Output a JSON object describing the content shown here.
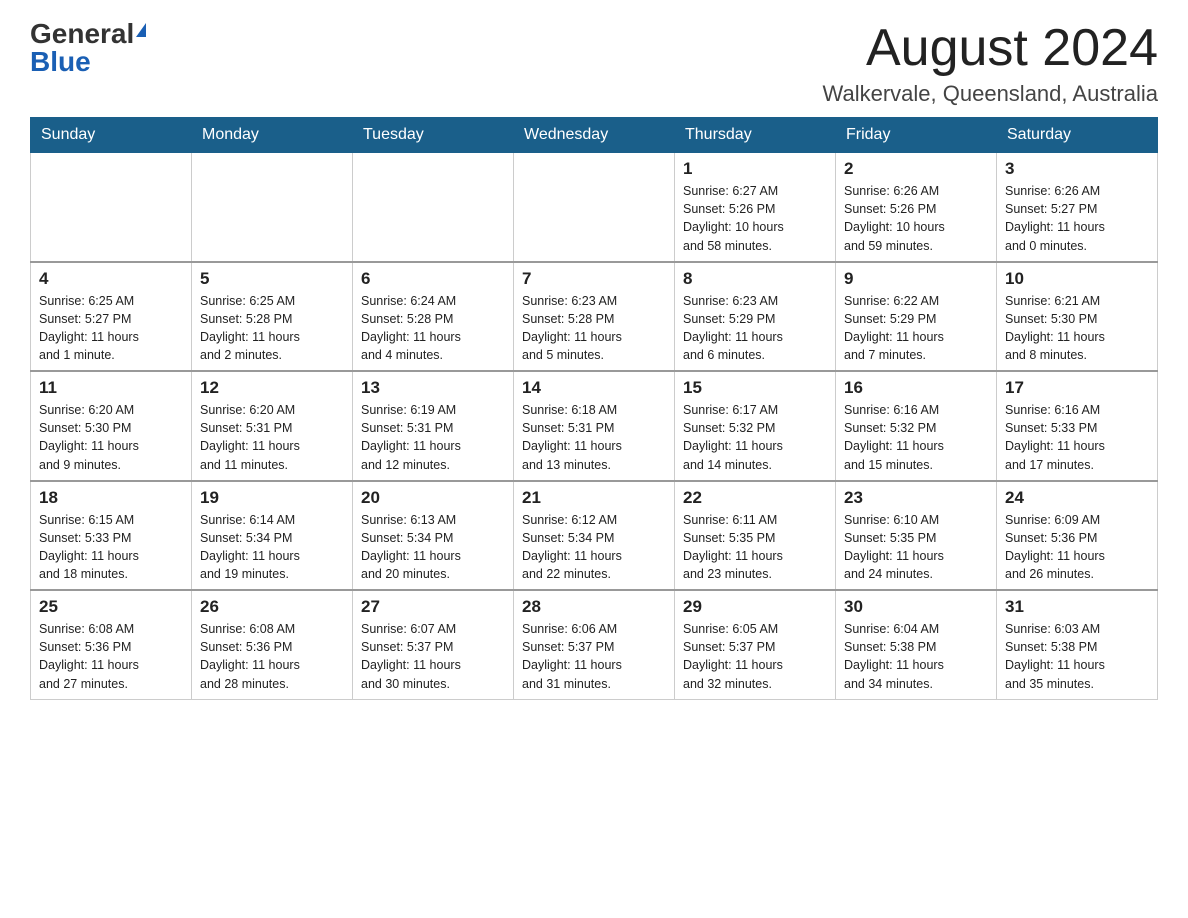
{
  "header": {
    "logo_general": "General",
    "logo_blue": "Blue",
    "month_title": "August 2024",
    "location": "Walkervale, Queensland, Australia"
  },
  "days_of_week": [
    "Sunday",
    "Monday",
    "Tuesday",
    "Wednesday",
    "Thursday",
    "Friday",
    "Saturday"
  ],
  "weeks": [
    [
      {
        "day": "",
        "info": ""
      },
      {
        "day": "",
        "info": ""
      },
      {
        "day": "",
        "info": ""
      },
      {
        "day": "",
        "info": ""
      },
      {
        "day": "1",
        "info": "Sunrise: 6:27 AM\nSunset: 5:26 PM\nDaylight: 10 hours\nand 58 minutes."
      },
      {
        "day": "2",
        "info": "Sunrise: 6:26 AM\nSunset: 5:26 PM\nDaylight: 10 hours\nand 59 minutes."
      },
      {
        "day": "3",
        "info": "Sunrise: 6:26 AM\nSunset: 5:27 PM\nDaylight: 11 hours\nand 0 minutes."
      }
    ],
    [
      {
        "day": "4",
        "info": "Sunrise: 6:25 AM\nSunset: 5:27 PM\nDaylight: 11 hours\nand 1 minute."
      },
      {
        "day": "5",
        "info": "Sunrise: 6:25 AM\nSunset: 5:28 PM\nDaylight: 11 hours\nand 2 minutes."
      },
      {
        "day": "6",
        "info": "Sunrise: 6:24 AM\nSunset: 5:28 PM\nDaylight: 11 hours\nand 4 minutes."
      },
      {
        "day": "7",
        "info": "Sunrise: 6:23 AM\nSunset: 5:28 PM\nDaylight: 11 hours\nand 5 minutes."
      },
      {
        "day": "8",
        "info": "Sunrise: 6:23 AM\nSunset: 5:29 PM\nDaylight: 11 hours\nand 6 minutes."
      },
      {
        "day": "9",
        "info": "Sunrise: 6:22 AM\nSunset: 5:29 PM\nDaylight: 11 hours\nand 7 minutes."
      },
      {
        "day": "10",
        "info": "Sunrise: 6:21 AM\nSunset: 5:30 PM\nDaylight: 11 hours\nand 8 minutes."
      }
    ],
    [
      {
        "day": "11",
        "info": "Sunrise: 6:20 AM\nSunset: 5:30 PM\nDaylight: 11 hours\nand 9 minutes."
      },
      {
        "day": "12",
        "info": "Sunrise: 6:20 AM\nSunset: 5:31 PM\nDaylight: 11 hours\nand 11 minutes."
      },
      {
        "day": "13",
        "info": "Sunrise: 6:19 AM\nSunset: 5:31 PM\nDaylight: 11 hours\nand 12 minutes."
      },
      {
        "day": "14",
        "info": "Sunrise: 6:18 AM\nSunset: 5:31 PM\nDaylight: 11 hours\nand 13 minutes."
      },
      {
        "day": "15",
        "info": "Sunrise: 6:17 AM\nSunset: 5:32 PM\nDaylight: 11 hours\nand 14 minutes."
      },
      {
        "day": "16",
        "info": "Sunrise: 6:16 AM\nSunset: 5:32 PM\nDaylight: 11 hours\nand 15 minutes."
      },
      {
        "day": "17",
        "info": "Sunrise: 6:16 AM\nSunset: 5:33 PM\nDaylight: 11 hours\nand 17 minutes."
      }
    ],
    [
      {
        "day": "18",
        "info": "Sunrise: 6:15 AM\nSunset: 5:33 PM\nDaylight: 11 hours\nand 18 minutes."
      },
      {
        "day": "19",
        "info": "Sunrise: 6:14 AM\nSunset: 5:34 PM\nDaylight: 11 hours\nand 19 minutes."
      },
      {
        "day": "20",
        "info": "Sunrise: 6:13 AM\nSunset: 5:34 PM\nDaylight: 11 hours\nand 20 minutes."
      },
      {
        "day": "21",
        "info": "Sunrise: 6:12 AM\nSunset: 5:34 PM\nDaylight: 11 hours\nand 22 minutes."
      },
      {
        "day": "22",
        "info": "Sunrise: 6:11 AM\nSunset: 5:35 PM\nDaylight: 11 hours\nand 23 minutes."
      },
      {
        "day": "23",
        "info": "Sunrise: 6:10 AM\nSunset: 5:35 PM\nDaylight: 11 hours\nand 24 minutes."
      },
      {
        "day": "24",
        "info": "Sunrise: 6:09 AM\nSunset: 5:36 PM\nDaylight: 11 hours\nand 26 minutes."
      }
    ],
    [
      {
        "day": "25",
        "info": "Sunrise: 6:08 AM\nSunset: 5:36 PM\nDaylight: 11 hours\nand 27 minutes."
      },
      {
        "day": "26",
        "info": "Sunrise: 6:08 AM\nSunset: 5:36 PM\nDaylight: 11 hours\nand 28 minutes."
      },
      {
        "day": "27",
        "info": "Sunrise: 6:07 AM\nSunset: 5:37 PM\nDaylight: 11 hours\nand 30 minutes."
      },
      {
        "day": "28",
        "info": "Sunrise: 6:06 AM\nSunset: 5:37 PM\nDaylight: 11 hours\nand 31 minutes."
      },
      {
        "day": "29",
        "info": "Sunrise: 6:05 AM\nSunset: 5:37 PM\nDaylight: 11 hours\nand 32 minutes."
      },
      {
        "day": "30",
        "info": "Sunrise: 6:04 AM\nSunset: 5:38 PM\nDaylight: 11 hours\nand 34 minutes."
      },
      {
        "day": "31",
        "info": "Sunrise: 6:03 AM\nSunset: 5:38 PM\nDaylight: 11 hours\nand 35 minutes."
      }
    ]
  ]
}
